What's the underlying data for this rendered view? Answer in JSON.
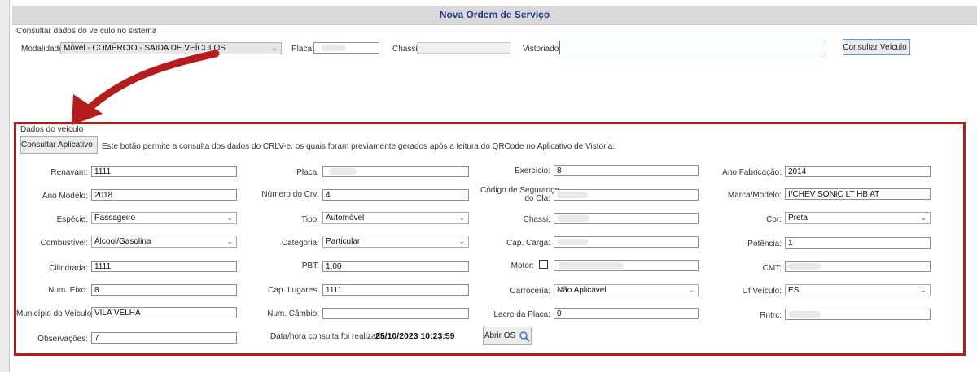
{
  "title": "Nova Ordem de Serviço",
  "consulta": {
    "section_label": "Consultar dados do veículo no sistema",
    "modalidade_label": "Modalidade:",
    "modalidade_value": "Móvel - COMÉRCIO - SAIDA DE VEÍCULOS",
    "placa_label": "Placa:",
    "placa_value": "",
    "chassi_label": "Chassi:",
    "chassi_value": "",
    "vistoriador_label": "Vistoriador:",
    "vistoriador_value": "",
    "button_label": "Consultar Veículo"
  },
  "dados": {
    "section_label": "Dados do veículo",
    "consultar_app_label": "Consultar Aplicativo",
    "info_text": "Este botão permite a consulta dos dados do CRLV-e, os quais foram previamente gerados após a leitura do QRCode no Aplicativo de Vistoria.",
    "renavam_label": "Renavam:",
    "renavam_value": "1111",
    "ano_modelo_label": "Ano Modelo:",
    "ano_modelo_value": "2018",
    "especie_label": "Espécie:",
    "especie_value": "Passageiro",
    "combustivel_label": "Combustível:",
    "combustivel_value": "Álcool/Gasolina",
    "cilindrada_label": "Cilindrada:",
    "cilindrada_value": "1111",
    "num_eixo_label": "Num. Eixo:",
    "num_eixo_value": "8",
    "municipio_label": "Município do Veículo:",
    "municipio_value": "VILA VELHA",
    "observacoes_label": "Observações:",
    "observacoes_value": "7",
    "placa_label": "Placa:",
    "placa_value": "",
    "numero_crv_label": "Número do Crv:",
    "numero_crv_value": "4",
    "tipo_label": "Tipo:",
    "tipo_value": "Automóvel",
    "categoria_label": "Categoria:",
    "categoria_value": "Particular",
    "pbt_label": "PBT:",
    "pbt_value": "1,00",
    "cap_lugares_label": "Cap. Lugares:",
    "cap_lugares_value": "1111",
    "num_cambio_label": "Num. Câmbio:",
    "num_cambio_value": "",
    "data_hora_label": "Data/hora consulta foi realizada:",
    "data_hora_value": "25/10/2023 10:23:59",
    "exercicio_label": "Exercício:",
    "exercicio_value": "8",
    "codigo_seg_label_1": "Código de Segurança",
    "codigo_seg_label_2": "do Cla:",
    "codigo_seg_value": "",
    "chassi_label": "Chassi:",
    "chassi_value": "",
    "cap_carga_label": "Cap. Carga:",
    "cap_carga_value": "",
    "motor_label": "Motor:",
    "motor_value": "",
    "carroceria_label": "Carroceria:",
    "carroceria_value": "Não Aplicável",
    "lacre_label": "Lacre da Placa:",
    "lacre_value": "0",
    "abrir_os_label": "Abrir OS",
    "ano_fab_label": "Ano Fabricação:",
    "ano_fab_value": "2014",
    "marca_label": "Marca/Modelo:",
    "marca_value": "I/CHEV SONIC LT HB AT",
    "cor_label": "Cor:",
    "cor_value": "Preta",
    "potencia_label": "Potência:",
    "potencia_value": "1",
    "cmt_label": "CMT:",
    "cmt_value": "",
    "uf_label": "Uf Veículo:",
    "uf_value": "ES",
    "rntrc_label": "Rntrc:",
    "rntrc_value": ""
  },
  "colors": {
    "title": "#1f3a8a",
    "highlight": "#b71c1c"
  },
  "icons": {
    "search": "magnifier-icon",
    "chevron": "chevron-down-icon",
    "arrow": "red-arrow-annotation"
  }
}
